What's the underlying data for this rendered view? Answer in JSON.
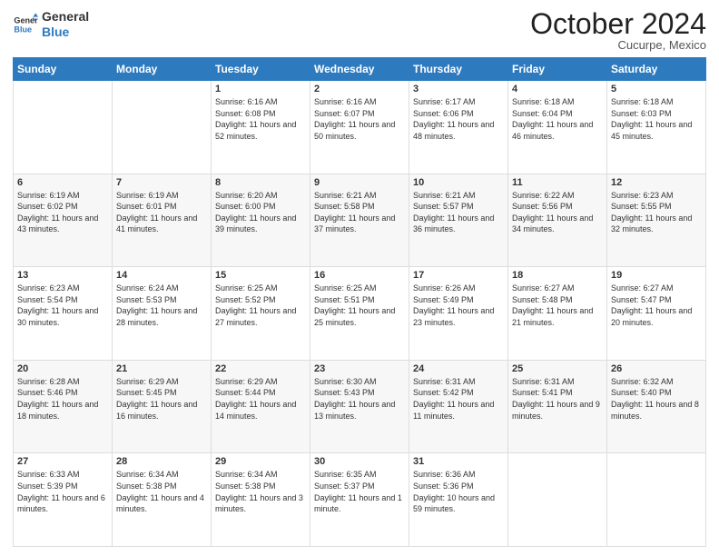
{
  "header": {
    "logo_line1": "General",
    "logo_line2": "Blue",
    "month": "October 2024",
    "location": "Cucurpe, Mexico"
  },
  "days_of_week": [
    "Sunday",
    "Monday",
    "Tuesday",
    "Wednesday",
    "Thursday",
    "Friday",
    "Saturday"
  ],
  "weeks": [
    [
      {
        "day": "",
        "sunrise": "",
        "sunset": "",
        "daylight": ""
      },
      {
        "day": "",
        "sunrise": "",
        "sunset": "",
        "daylight": ""
      },
      {
        "day": "1",
        "sunrise": "Sunrise: 6:16 AM",
        "sunset": "Sunset: 6:08 PM",
        "daylight": "Daylight: 11 hours and 52 minutes."
      },
      {
        "day": "2",
        "sunrise": "Sunrise: 6:16 AM",
        "sunset": "Sunset: 6:07 PM",
        "daylight": "Daylight: 11 hours and 50 minutes."
      },
      {
        "day": "3",
        "sunrise": "Sunrise: 6:17 AM",
        "sunset": "Sunset: 6:06 PM",
        "daylight": "Daylight: 11 hours and 48 minutes."
      },
      {
        "day": "4",
        "sunrise": "Sunrise: 6:18 AM",
        "sunset": "Sunset: 6:04 PM",
        "daylight": "Daylight: 11 hours and 46 minutes."
      },
      {
        "day": "5",
        "sunrise": "Sunrise: 6:18 AM",
        "sunset": "Sunset: 6:03 PM",
        "daylight": "Daylight: 11 hours and 45 minutes."
      }
    ],
    [
      {
        "day": "6",
        "sunrise": "Sunrise: 6:19 AM",
        "sunset": "Sunset: 6:02 PM",
        "daylight": "Daylight: 11 hours and 43 minutes."
      },
      {
        "day": "7",
        "sunrise": "Sunrise: 6:19 AM",
        "sunset": "Sunset: 6:01 PM",
        "daylight": "Daylight: 11 hours and 41 minutes."
      },
      {
        "day": "8",
        "sunrise": "Sunrise: 6:20 AM",
        "sunset": "Sunset: 6:00 PM",
        "daylight": "Daylight: 11 hours and 39 minutes."
      },
      {
        "day": "9",
        "sunrise": "Sunrise: 6:21 AM",
        "sunset": "Sunset: 5:58 PM",
        "daylight": "Daylight: 11 hours and 37 minutes."
      },
      {
        "day": "10",
        "sunrise": "Sunrise: 6:21 AM",
        "sunset": "Sunset: 5:57 PM",
        "daylight": "Daylight: 11 hours and 36 minutes."
      },
      {
        "day": "11",
        "sunrise": "Sunrise: 6:22 AM",
        "sunset": "Sunset: 5:56 PM",
        "daylight": "Daylight: 11 hours and 34 minutes."
      },
      {
        "day": "12",
        "sunrise": "Sunrise: 6:23 AM",
        "sunset": "Sunset: 5:55 PM",
        "daylight": "Daylight: 11 hours and 32 minutes."
      }
    ],
    [
      {
        "day": "13",
        "sunrise": "Sunrise: 6:23 AM",
        "sunset": "Sunset: 5:54 PM",
        "daylight": "Daylight: 11 hours and 30 minutes."
      },
      {
        "day": "14",
        "sunrise": "Sunrise: 6:24 AM",
        "sunset": "Sunset: 5:53 PM",
        "daylight": "Daylight: 11 hours and 28 minutes."
      },
      {
        "day": "15",
        "sunrise": "Sunrise: 6:25 AM",
        "sunset": "Sunset: 5:52 PM",
        "daylight": "Daylight: 11 hours and 27 minutes."
      },
      {
        "day": "16",
        "sunrise": "Sunrise: 6:25 AM",
        "sunset": "Sunset: 5:51 PM",
        "daylight": "Daylight: 11 hours and 25 minutes."
      },
      {
        "day": "17",
        "sunrise": "Sunrise: 6:26 AM",
        "sunset": "Sunset: 5:49 PM",
        "daylight": "Daylight: 11 hours and 23 minutes."
      },
      {
        "day": "18",
        "sunrise": "Sunrise: 6:27 AM",
        "sunset": "Sunset: 5:48 PM",
        "daylight": "Daylight: 11 hours and 21 minutes."
      },
      {
        "day": "19",
        "sunrise": "Sunrise: 6:27 AM",
        "sunset": "Sunset: 5:47 PM",
        "daylight": "Daylight: 11 hours and 20 minutes."
      }
    ],
    [
      {
        "day": "20",
        "sunrise": "Sunrise: 6:28 AM",
        "sunset": "Sunset: 5:46 PM",
        "daylight": "Daylight: 11 hours and 18 minutes."
      },
      {
        "day": "21",
        "sunrise": "Sunrise: 6:29 AM",
        "sunset": "Sunset: 5:45 PM",
        "daylight": "Daylight: 11 hours and 16 minutes."
      },
      {
        "day": "22",
        "sunrise": "Sunrise: 6:29 AM",
        "sunset": "Sunset: 5:44 PM",
        "daylight": "Daylight: 11 hours and 14 minutes."
      },
      {
        "day": "23",
        "sunrise": "Sunrise: 6:30 AM",
        "sunset": "Sunset: 5:43 PM",
        "daylight": "Daylight: 11 hours and 13 minutes."
      },
      {
        "day": "24",
        "sunrise": "Sunrise: 6:31 AM",
        "sunset": "Sunset: 5:42 PM",
        "daylight": "Daylight: 11 hours and 11 minutes."
      },
      {
        "day": "25",
        "sunrise": "Sunrise: 6:31 AM",
        "sunset": "Sunset: 5:41 PM",
        "daylight": "Daylight: 11 hours and 9 minutes."
      },
      {
        "day": "26",
        "sunrise": "Sunrise: 6:32 AM",
        "sunset": "Sunset: 5:40 PM",
        "daylight": "Daylight: 11 hours and 8 minutes."
      }
    ],
    [
      {
        "day": "27",
        "sunrise": "Sunrise: 6:33 AM",
        "sunset": "Sunset: 5:39 PM",
        "daylight": "Daylight: 11 hours and 6 minutes."
      },
      {
        "day": "28",
        "sunrise": "Sunrise: 6:34 AM",
        "sunset": "Sunset: 5:38 PM",
        "daylight": "Daylight: 11 hours and 4 minutes."
      },
      {
        "day": "29",
        "sunrise": "Sunrise: 6:34 AM",
        "sunset": "Sunset: 5:38 PM",
        "daylight": "Daylight: 11 hours and 3 minutes."
      },
      {
        "day": "30",
        "sunrise": "Sunrise: 6:35 AM",
        "sunset": "Sunset: 5:37 PM",
        "daylight": "Daylight: 11 hours and 1 minute."
      },
      {
        "day": "31",
        "sunrise": "Sunrise: 6:36 AM",
        "sunset": "Sunset: 5:36 PM",
        "daylight": "Daylight: 10 hours and 59 minutes."
      },
      {
        "day": "",
        "sunrise": "",
        "sunset": "",
        "daylight": ""
      },
      {
        "day": "",
        "sunrise": "",
        "sunset": "",
        "daylight": ""
      }
    ]
  ]
}
